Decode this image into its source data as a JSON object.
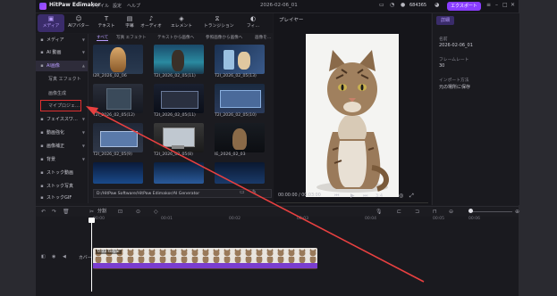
{
  "titlebar": {
    "app_name": "HitPaw Edimakor",
    "menu": [
      "ファイル",
      "設定",
      "ヘルプ"
    ],
    "date_title": "2026-02-06_01",
    "credits": "684365",
    "export_label": "エクスポート"
  },
  "toolbar": {
    "tools": [
      {
        "label": "メディア",
        "icon": "folder-icon"
      },
      {
        "label": "AIアバター",
        "icon": "avatar-icon"
      },
      {
        "label": "テキスト",
        "icon": "text-icon"
      },
      {
        "label": "字幕",
        "icon": "subtitle-icon"
      },
      {
        "label": "オーディオ",
        "icon": "audio-icon"
      },
      {
        "label": "エレメント",
        "icon": "element-icon"
      },
      {
        "label": "トランジション",
        "icon": "transition-icon"
      },
      {
        "label": "フィ…",
        "icon": "filter-icon"
      }
    ]
  },
  "sidebar": {
    "items": [
      {
        "label": "メディア",
        "icon": "folder-icon"
      },
      {
        "label": "AI 動画",
        "icon": "video-icon"
      },
      {
        "label": "AI画像",
        "icon": "image-icon"
      },
      {
        "label": "写真 エフェクト",
        "icon": ""
      },
      {
        "label": "画像生成",
        "icon": ""
      },
      {
        "label": "マイプロジェ…",
        "icon": ""
      },
      {
        "label": "フェイススワ…",
        "icon": "face-icon"
      },
      {
        "label": "動画強化",
        "icon": "enhance-icon"
      },
      {
        "label": "画像補正",
        "icon": "correct-icon"
      },
      {
        "label": "背景",
        "icon": "background-icon"
      },
      {
        "label": "ストック動画",
        "icon": "stock-video-icon"
      },
      {
        "label": "ストック写真",
        "icon": "stock-photo-icon"
      },
      {
        "label": "ストックGIF",
        "icon": "gif-icon"
      }
    ]
  },
  "media_tabs": [
    "すべて",
    "写真 エフェクト",
    "テキストから画像へ",
    "参照画像から画像へ",
    "画像を…"
  ],
  "media_items": [
    {
      "name": "I2R_2026_02_06"
    },
    {
      "name": "T2I_2026_02_05(11)"
    },
    {
      "name": "T2I_2026_02_05(13)"
    },
    {
      "name": "T2I_2026_02_05(12)"
    },
    {
      "name": "T2I_2026_02_05(11)"
    },
    {
      "name": "T2I_2026_02_05(10)"
    },
    {
      "name": "T2I_2026_02_05(9)"
    },
    {
      "name": "T2I_2026_02_05(8)"
    },
    {
      "name": "IE_2026_02_03"
    },
    {
      "name": ""
    },
    {
      "name": ""
    },
    {
      "name": ""
    }
  ],
  "path_bar": "D:/HitPaw Software/HitPaw Edimakor/AI Generator",
  "preview": {
    "title": "プレイヤー",
    "time": "00:00:00 / 00:03:00",
    "ratio": "3:4"
  },
  "details": {
    "tab": "詳細",
    "rows": [
      {
        "label": "名前",
        "value": "2026-02-06_01"
      },
      {
        "label": "フレームレート",
        "value": "30"
      },
      {
        "label": "インポート方法",
        "value": "元の場所に保存"
      }
    ]
  },
  "timeline": {
    "split_label": "分割",
    "ruler": [
      "00:00",
      "00:01",
      "00:02",
      "00:03",
      "00:04",
      "00:05",
      "00:06"
    ],
    "track_label": "カバー",
    "clip_label": "0:03 solyai"
  },
  "colors": {
    "accent": "#8a3dff",
    "highlight": "#e03030",
    "arrow": "#e84040"
  }
}
